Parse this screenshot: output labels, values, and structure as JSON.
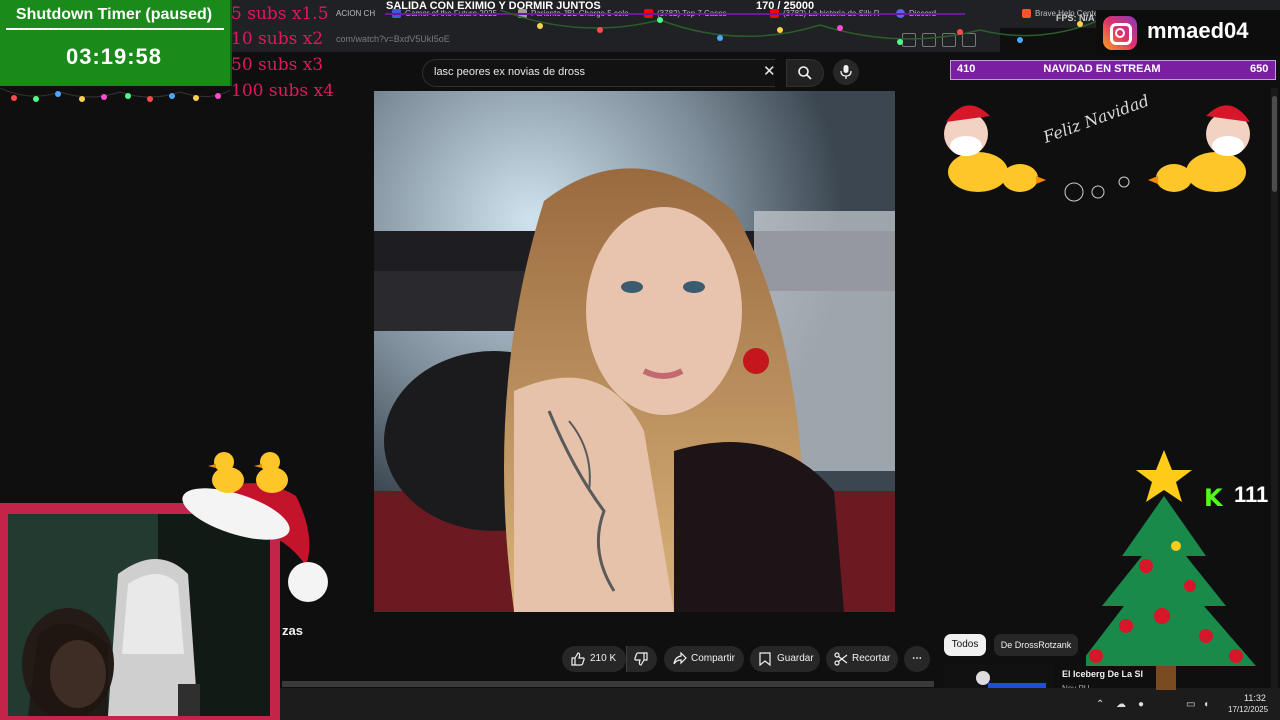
{
  "browser": {
    "tabs": [
      {
        "label": "ACION CH",
        "color": "#888888"
      },
      {
        "label": "Gamer of the Future 2025",
        "color": "#3b5bdb"
      },
      {
        "label": "Pariente JBL Charge 5 colo",
        "color": "#9e9e9e"
      },
      {
        "label": "(3782) Top 7 Casos",
        "color": "#ff0000"
      },
      {
        "label": "(3782) La historia de Silk R",
        "color": "#ff0000"
      },
      {
        "label": "Discord",
        "color": "#5865f2"
      },
      {
        "label": "Brave Help Center",
        "color": "#fb542b"
      }
    ],
    "url": "com/watch?v=BxdV5UkI5oE"
  },
  "search": {
    "query": "lasc peores ex novias de dross"
  },
  "video": {
    "title_fragment": "zas"
  },
  "actions": {
    "likes": "210 K",
    "share": "Compartir",
    "save": "Guardar",
    "clip": "Recortar",
    "more": "⋯"
  },
  "chips": {
    "all": "Todos",
    "channel": "De DrossRotzank"
  },
  "recommendation": {
    "title": "El Iceberg De La Sl",
    "channel": "Nov PU"
  },
  "taskbar": {
    "time": "11:32",
    "date": "17/12/2025"
  },
  "overlays": {
    "timer_title": "Shutdown Timer (paused)",
    "timer_value": "03:19:58",
    "subs_multipliers": [
      "5 subs x1.5",
      "10 subs x2",
      "50 subs x3",
      "100 subs x4"
    ],
    "sub_goal_text": "SALIDA CON EXIMIO Y DORMIR JUNTOS",
    "sub_goal_count": "170   / 25000",
    "instagram_user": "mmaed04",
    "fps_label": "FPS: N/A",
    "xmas_left": "410",
    "xmas_title": "NAVIDAD EN STREAM",
    "xmas_right": "650",
    "kick_logo": "K",
    "kick_count": "111",
    "feliz_navidad": "Feliz Navidad"
  },
  "colors": {
    "timer_bg": "#1a8a1a",
    "subs_text": "#e0195c",
    "xmas_bar": "#7b1fa2",
    "kick_green": "#53fc18",
    "webcam_frame": "#c2244a"
  }
}
